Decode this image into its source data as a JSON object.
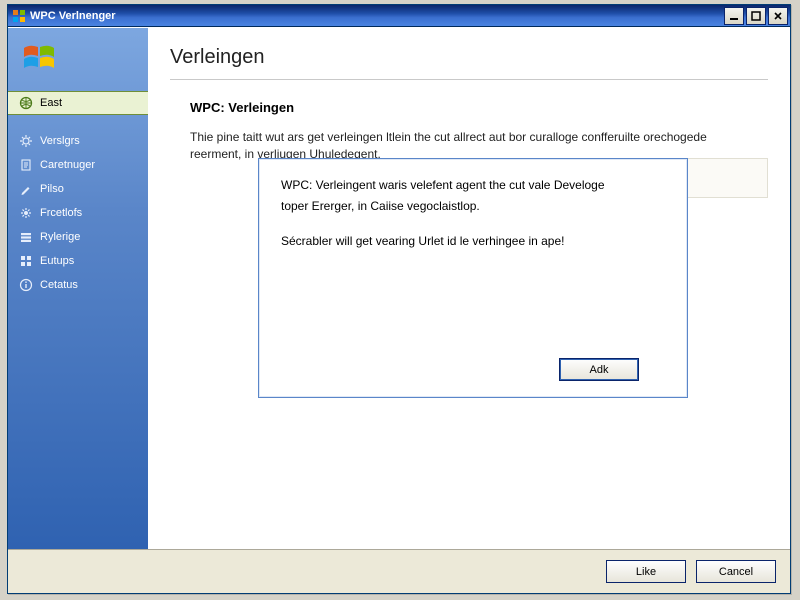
{
  "titlebar": {
    "title": "WPC Verlnenger"
  },
  "sidebar": {
    "items": [
      {
        "label": "East",
        "icon": "globe-icon",
        "selected": true
      },
      {
        "label": "Verslgrs",
        "icon": "gear-icon",
        "selected": false
      },
      {
        "label": "Caretnuger",
        "icon": "doc-icon",
        "selected": false
      },
      {
        "label": "Pilso",
        "icon": "brush-icon",
        "selected": false
      },
      {
        "label": "Frcetlofs",
        "icon": "flower-icon",
        "selected": false
      },
      {
        "label": "Rylerige",
        "icon": "stack-icon",
        "selected": false
      },
      {
        "label": "Eutups",
        "icon": "grid-icon",
        "selected": false
      },
      {
        "label": "Cetatus",
        "icon": "info-icon",
        "selected": false
      }
    ]
  },
  "page": {
    "heading": "Verleingen",
    "subtitle": "WPC: Verleingen",
    "description": "Thie pine taitt wut ars get verleingen ltlein the cut allrect aut bor curalloge confferuilte orechogede reerment, in verliugen Uhuledegent."
  },
  "dialog": {
    "line1": "WPC: Verleingent waris velefent agent the cut vale Develoge",
    "line2": "toper Ererger, in Caiise vegoclaistlop.",
    "line3": "Sécrabler will get vearing Urlet id le verhingee in ape!",
    "ok_label": "Adk"
  },
  "footer": {
    "primary_label": "Like",
    "cancel_label": "Cancel"
  }
}
